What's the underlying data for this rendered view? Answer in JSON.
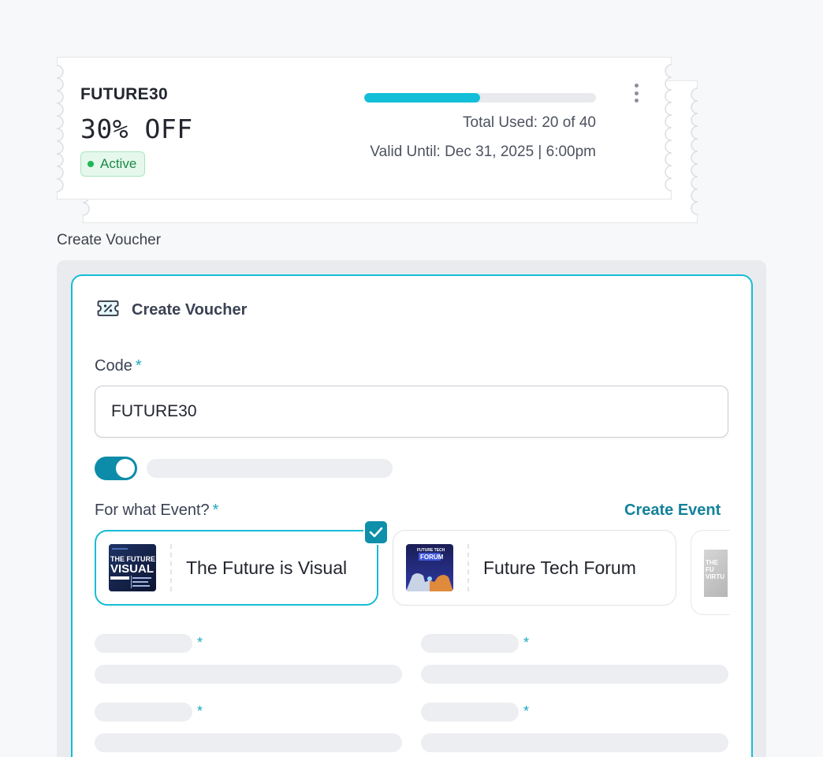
{
  "voucher": {
    "code": "FUTURE30",
    "discount": "30% OFF",
    "status": "Active",
    "usage_fraction": 0.5,
    "total_used": "Total Used: 20 of 40",
    "valid_until": "Valid Until: Dec 31, 2025  | 6:00pm",
    "menu_icon": "more-vertical-icon"
  },
  "section_label": "Create Voucher",
  "form": {
    "title": "Create Voucher",
    "title_icon": "ticket-percent-icon",
    "code_label": "Code",
    "required_mark": "*",
    "code_value": "FUTURE30",
    "toggle_on": true,
    "event_label": "For what Event?",
    "create_event": "Create Event",
    "events": [
      {
        "name": "The Future is Visual",
        "selected": true,
        "thumb_text": "THE FUTURE IS VISUAL"
      },
      {
        "name": "Future Tech Forum",
        "selected": false,
        "thumb_text": "FUTURE TECH FORUM"
      }
    ],
    "partial_event_thumb_text": "THE FU VIRTU"
  },
  "colors": {
    "accent": "#17bcd6",
    "accent_dark": "#0f8fa9",
    "active_green": "#20b757",
    "progress_fill": "#13bfd8"
  }
}
